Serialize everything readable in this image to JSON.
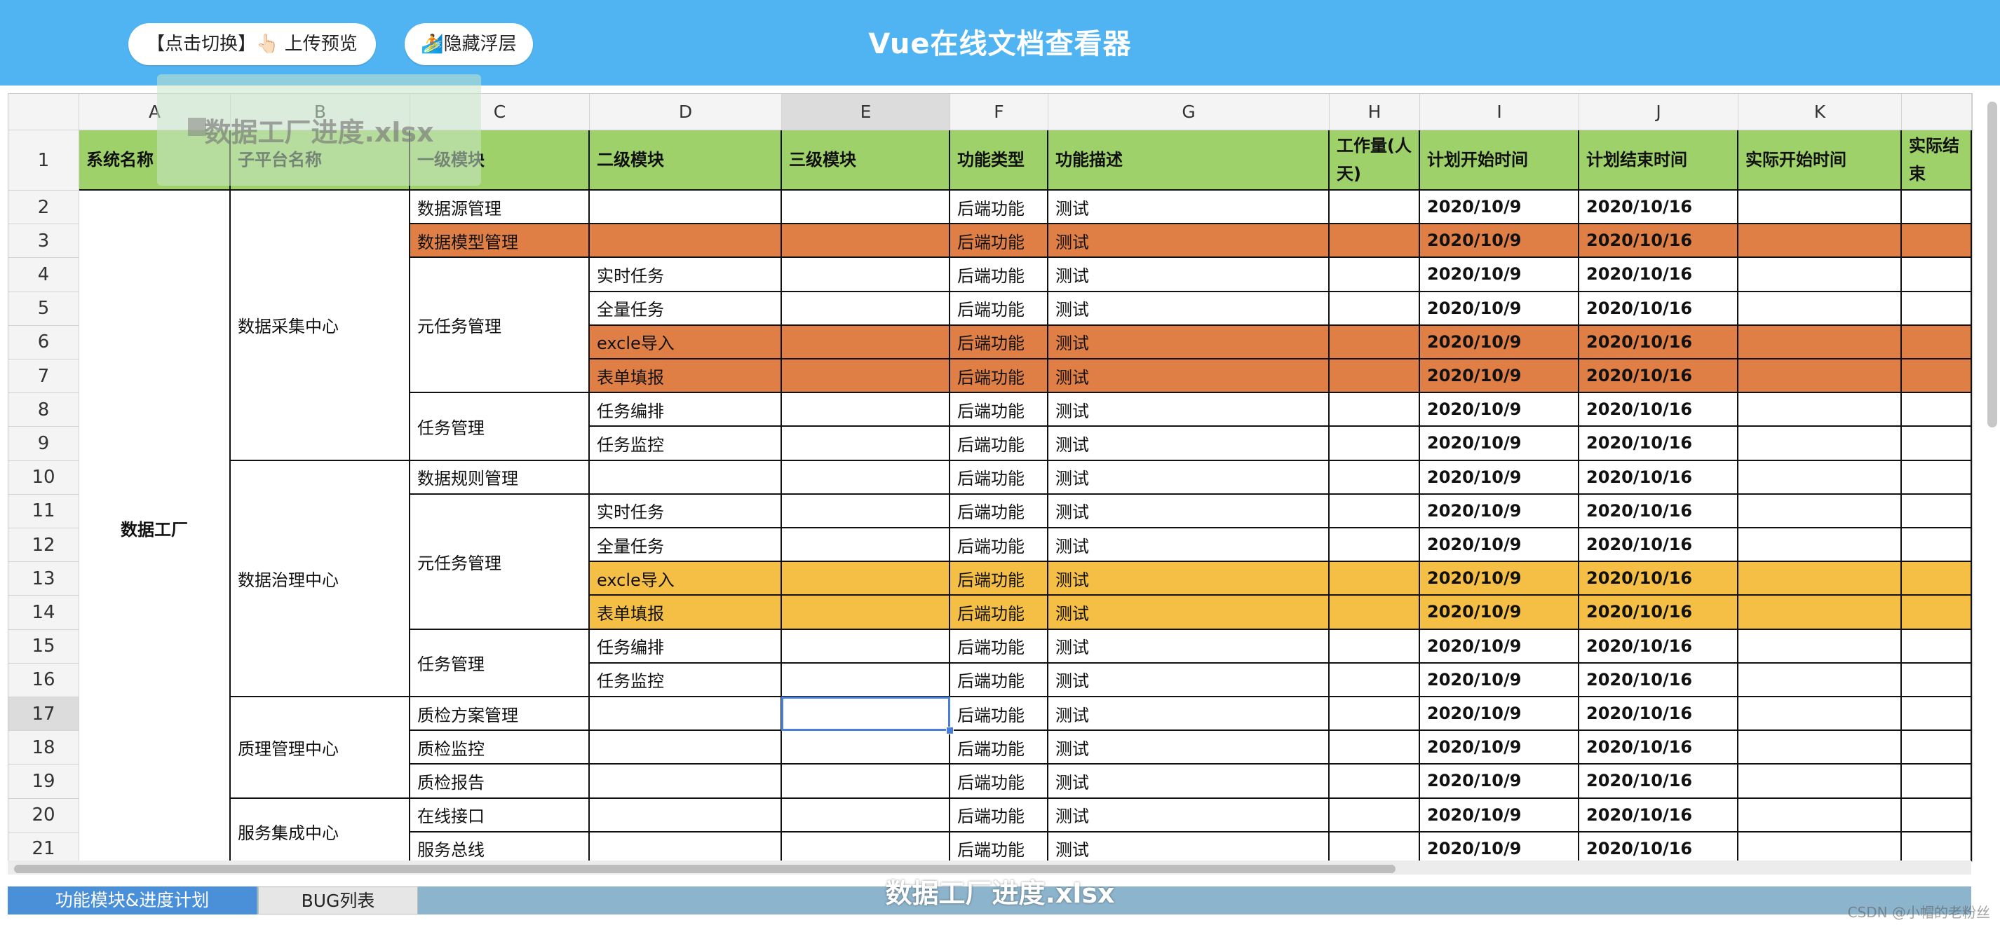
{
  "app": {
    "title": "Vue在线文档查看器",
    "toggle_button": "【点击切换】👆🏻 上传预览",
    "hide_button": "🏄隐藏浮层",
    "overlay_filename": "数据工厂进度.xlsx",
    "footer_filename": "数据工厂进度.xlsx",
    "watermark": "CSDN @小帽的老粉丝"
  },
  "sheet": {
    "columns": [
      "A",
      "B",
      "C",
      "D",
      "E",
      "F",
      "G",
      "H",
      "I",
      "J",
      "K"
    ],
    "header_row": [
      "系统名称",
      "子平台名称",
      "一级模块",
      "二级模块",
      "三级模块",
      "功能类型",
      "功能描述",
      "工作量(人天)",
      "计划开始时间",
      "计划结束时间",
      "实际开始时间",
      "实际结束"
    ],
    "row_numbers": [
      "1",
      "2",
      "3",
      "4",
      "5",
      "6",
      "7",
      "8",
      "9",
      "10",
      "11",
      "12",
      "13",
      "14",
      "15",
      "16",
      "17",
      "18",
      "19",
      "20",
      "21"
    ],
    "system_name": "数据工厂",
    "subplatforms": [
      "数据采集中心",
      "数据治理中心",
      "质理管理中心",
      "服务集成中心"
    ],
    "level1": [
      "数据源管理",
      "数据模型管理",
      "元任务管理",
      "任务管理",
      "数据规则管理",
      "元任务管理",
      "任务管理",
      "质检方案管理",
      "质检监控",
      "质检报告",
      "在线接口",
      "服务总线"
    ],
    "level2": [
      "实时任务",
      "全量任务",
      "excle导入",
      "表单填报",
      "任务编排",
      "任务监控",
      "实时任务",
      "全量任务",
      "excle导入",
      "表单填报",
      "任务编排",
      "任务监控"
    ],
    "func_type": "后端功能",
    "func_desc": "测试",
    "plan_start": "2020/10/9",
    "plan_end": "2020/10/16",
    "colors": {
      "header_green": "#9fd16a",
      "orange": "#e07f45",
      "yellow": "#f5be44",
      "selection": "#4a7fd9"
    }
  },
  "tabs": [
    "功能模块&进度计划",
    "BUG列表"
  ]
}
